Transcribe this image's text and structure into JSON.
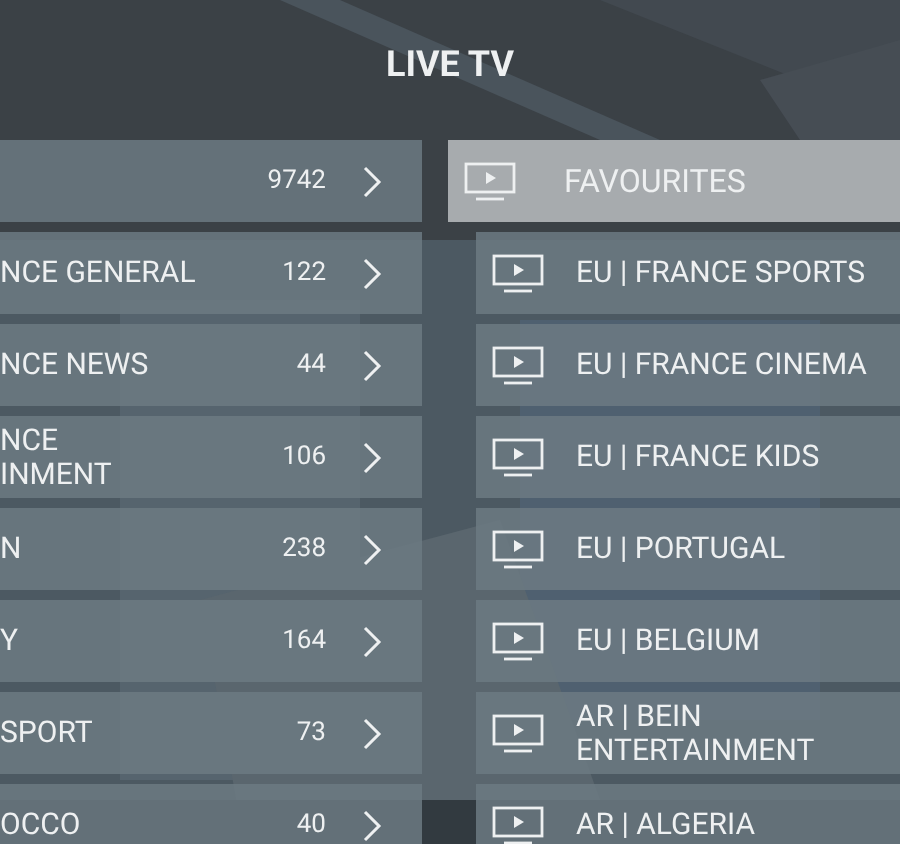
{
  "title": "LIVE TV",
  "categories": [
    {
      "count": "9742"
    },
    {
      "lines": [
        "NCE GENERAL"
      ],
      "count": "122"
    },
    {
      "lines": [
        "NCE NEWS"
      ],
      "count": "44"
    },
    {
      "lines": [
        "NCE",
        "INMENT"
      ],
      "count": "106"
    },
    {
      "lines": [
        "N"
      ],
      "count": "238"
    },
    {
      "lines": [
        "Y"
      ],
      "count": "164"
    },
    {
      "lines": [
        "SPORT"
      ],
      "count": "73"
    },
    {
      "lines": [
        "OCCO"
      ],
      "count": "40"
    }
  ],
  "groups": [
    {
      "label": "FAVOURITES",
      "selected": true
    },
    {
      "label": "EU | FRANCE SPORTS",
      "selected": false
    },
    {
      "label": "EU | FRANCE CINEMA",
      "selected": false
    },
    {
      "label": "EU | FRANCE KIDS",
      "selected": false
    },
    {
      "label": "EU | PORTUGAL",
      "selected": false
    },
    {
      "label": "EU | BELGIUM",
      "selected": false
    },
    {
      "label": "AR | BEIN ENTERTAINMENT",
      "selected": false
    },
    {
      "label": "AR | ALGERIA",
      "selected": false
    }
  ]
}
